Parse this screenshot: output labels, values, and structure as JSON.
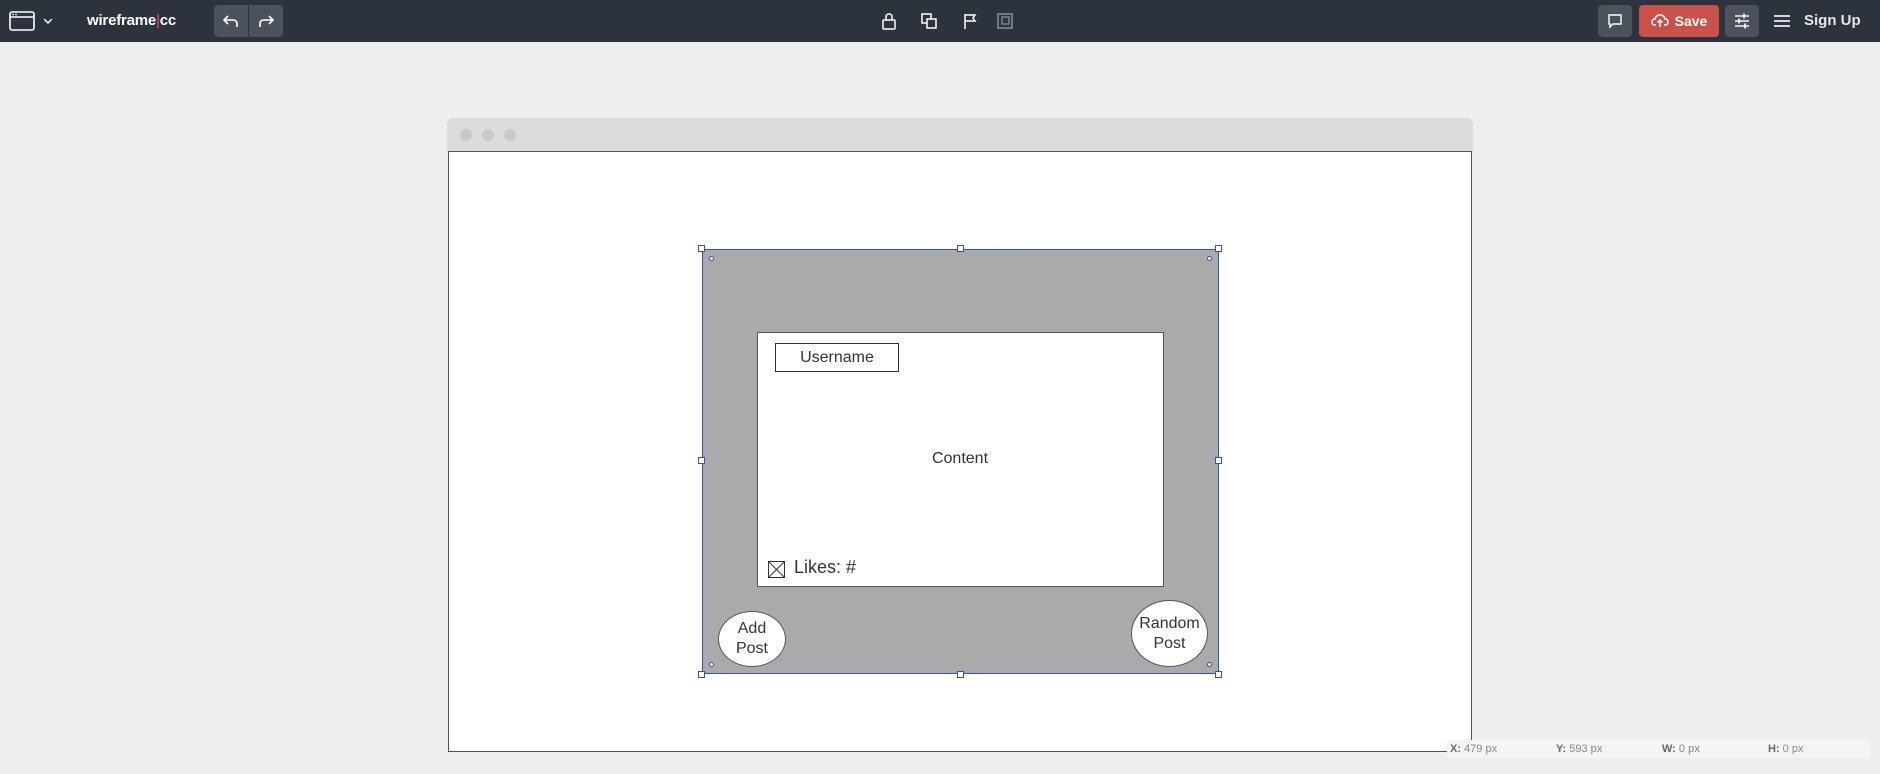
{
  "app": {
    "logo_prefix": "wireframe",
    "logo_cursor": "|",
    "logo_suffix": "cc"
  },
  "toolbar": {
    "frame_menu_icon": "browser-window-icon",
    "undo_icon": "undo-arrow-icon",
    "redo_icon": "redo-arrow-icon",
    "tools": [
      "lock-icon",
      "duplicate-icon",
      "flag-icon",
      "layer-icon"
    ],
    "save_label": "Save",
    "signup_label": "Sign Up"
  },
  "canvas": {
    "username_label": "Username",
    "content_label": "Content",
    "likes_label": "Likes: #",
    "add_post_label": [
      "Add",
      "Post"
    ],
    "random_post_label": [
      "Random",
      "Post"
    ]
  },
  "status": {
    "x_label": "X:",
    "x_value": "479 px",
    "y_label": "Y:",
    "y_value": "593 px",
    "w_label": "W:",
    "w_value": "0 px",
    "h_label": "H:",
    "h_value": "0 px"
  },
  "colors": {
    "topbar": "#2d333c",
    "save": "#c8514a",
    "selection": "#2b57b6",
    "panel_grey": "#aaaaaa"
  }
}
